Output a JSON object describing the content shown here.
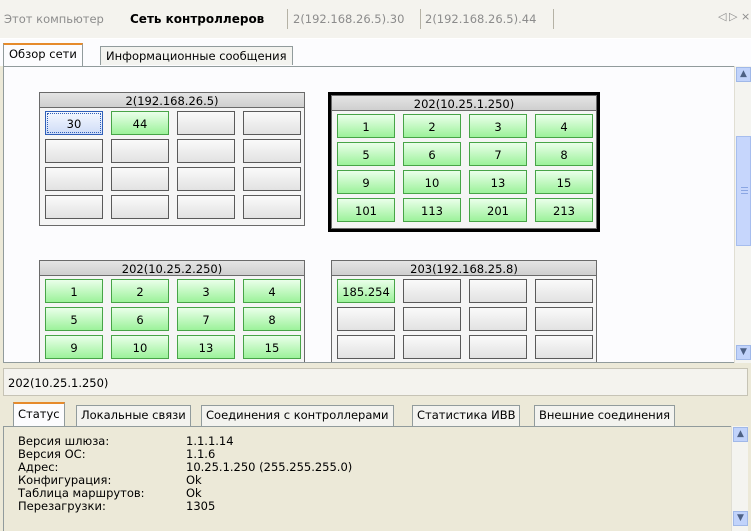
{
  "top_tabs": [
    {
      "label": "Этот компьютер",
      "active": false
    },
    {
      "label": "Сеть контроллеров",
      "active": true
    },
    {
      "label": "2(192.168.26.5).30",
      "active": false
    },
    {
      "label": "2(192.168.26.5).44",
      "active": false
    }
  ],
  "top_nav": {
    "left": "◁",
    "right": "▷",
    "close": "×"
  },
  "inner_tabs": [
    {
      "label": "Обзор сети",
      "active": true
    },
    {
      "label": "Информационные сообщения",
      "active": false
    }
  ],
  "network": {
    "groups": [
      {
        "title": "2(192.168.26.5)",
        "selected": false,
        "cells": [
          {
            "label": "30",
            "state": "selected"
          },
          {
            "label": "44",
            "state": "online"
          },
          {
            "label": "",
            "state": "empty"
          },
          {
            "label": "",
            "state": "empty"
          },
          {
            "label": "",
            "state": "empty"
          },
          {
            "label": "",
            "state": "empty"
          },
          {
            "label": "",
            "state": "empty"
          },
          {
            "label": "",
            "state": "empty"
          },
          {
            "label": "",
            "state": "empty"
          },
          {
            "label": "",
            "state": "empty"
          },
          {
            "label": "",
            "state": "empty"
          },
          {
            "label": "",
            "state": "empty"
          },
          {
            "label": "",
            "state": "empty"
          },
          {
            "label": "",
            "state": "empty"
          },
          {
            "label": "",
            "state": "empty"
          },
          {
            "label": "",
            "state": "empty"
          }
        ]
      },
      {
        "title": "202(10.25.1.250)",
        "selected": true,
        "cells": [
          {
            "label": "1",
            "state": "online"
          },
          {
            "label": "2",
            "state": "online"
          },
          {
            "label": "3",
            "state": "online"
          },
          {
            "label": "4",
            "state": "online"
          },
          {
            "label": "5",
            "state": "online"
          },
          {
            "label": "6",
            "state": "online"
          },
          {
            "label": "7",
            "state": "online"
          },
          {
            "label": "8",
            "state": "online"
          },
          {
            "label": "9",
            "state": "online"
          },
          {
            "label": "10",
            "state": "online"
          },
          {
            "label": "13",
            "state": "online"
          },
          {
            "label": "15",
            "state": "online"
          },
          {
            "label": "101",
            "state": "online"
          },
          {
            "label": "113",
            "state": "online"
          },
          {
            "label": "201",
            "state": "online"
          },
          {
            "label": "213",
            "state": "online"
          }
        ]
      },
      {
        "title": "202(10.25.2.250)",
        "selected": false,
        "cells": [
          {
            "label": "1",
            "state": "online"
          },
          {
            "label": "2",
            "state": "online"
          },
          {
            "label": "3",
            "state": "online"
          },
          {
            "label": "4",
            "state": "online"
          },
          {
            "label": "5",
            "state": "online"
          },
          {
            "label": "6",
            "state": "online"
          },
          {
            "label": "7",
            "state": "online"
          },
          {
            "label": "8",
            "state": "online"
          },
          {
            "label": "9",
            "state": "online"
          },
          {
            "label": "10",
            "state": "online"
          },
          {
            "label": "13",
            "state": "online"
          },
          {
            "label": "15",
            "state": "online"
          }
        ]
      },
      {
        "title": "203(192.168.25.8)",
        "selected": false,
        "cells": [
          {
            "label": "185.254",
            "state": "online"
          },
          {
            "label": "",
            "state": "empty"
          },
          {
            "label": "",
            "state": "empty"
          },
          {
            "label": "",
            "state": "empty"
          },
          {
            "label": "",
            "state": "empty"
          },
          {
            "label": "",
            "state": "empty"
          },
          {
            "label": "",
            "state": "empty"
          },
          {
            "label": "",
            "state": "empty"
          },
          {
            "label": "",
            "state": "empty"
          },
          {
            "label": "",
            "state": "empty"
          },
          {
            "label": "",
            "state": "empty"
          },
          {
            "label": "",
            "state": "empty"
          }
        ]
      }
    ]
  },
  "detail": {
    "title": "202(10.25.1.250)",
    "tabs": [
      {
        "label": "Статус",
        "active": true
      },
      {
        "label": "Локальные связи",
        "active": false
      },
      {
        "label": "Соединения с контроллерами",
        "active": false
      },
      {
        "label": "Статистика ИВВ",
        "active": false
      },
      {
        "label": "Внешние соединения",
        "active": false
      }
    ],
    "status_rows": [
      {
        "key": "Версия шлюза:",
        "value": "1.1.1.14"
      },
      {
        "key": "Версия ОС:",
        "value": "1.1.6"
      },
      {
        "key": "Адрес:",
        "value": "10.25.1.250 (255.255.255.0)"
      },
      {
        "key": "Конфигурация:",
        "value": "Ok"
      },
      {
        "key": "Таблица маршрутов:",
        "value": "Ok"
      },
      {
        "key": "Перезагрузки:",
        "value": "1305"
      }
    ]
  },
  "scrollbar_icons": {
    "up": "▲",
    "down": "▼"
  },
  "colors": {
    "online": "#9cf29a",
    "empty": "#e2e2e2",
    "selected": "#cfdcf7",
    "tab_accent": "#e68b2c"
  }
}
